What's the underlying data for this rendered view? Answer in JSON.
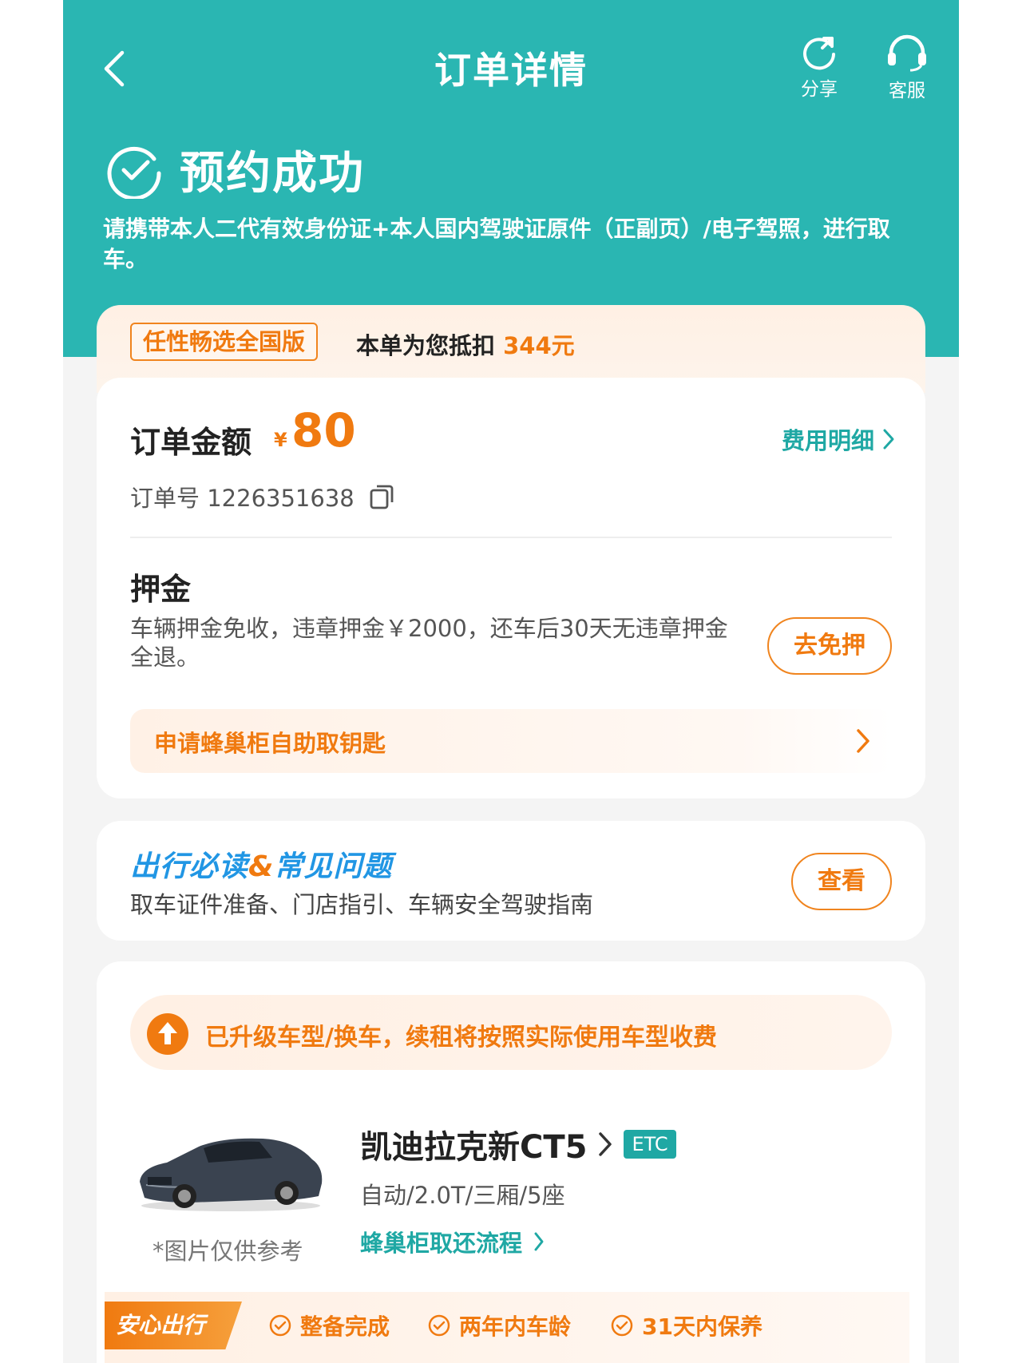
{
  "header": {
    "title": "订单详情",
    "share_label": "分享",
    "service_label": "客服"
  },
  "status": {
    "title": "预约成功",
    "notice": "请携带本人二代有效身份证+本人国内驾驶证原件（正副页）/电子驾照，进行取车。"
  },
  "promo": {
    "tag": "任性畅选全国版",
    "text_prefix": "本单为您抵扣",
    "amount": "344元"
  },
  "order": {
    "label": "订单金额",
    "currency": "¥",
    "amount": "80",
    "fee_link": "费用明细",
    "order_no": "订单号 1226351638"
  },
  "deposit": {
    "title": "押金",
    "desc": "车辆押金免收，违章押金￥2000，还车后30天无违章押金全退。",
    "button": "去免押",
    "locker_link": "申请蜂巢柜自助取钥匙"
  },
  "guide": {
    "title_a": "出行必读",
    "title_amp": "&",
    "title_b": "常见问题",
    "subtitle": "取车证件准备、门店指引、车辆安全驾驶指南",
    "button": "查看"
  },
  "car": {
    "upgrade_notice": "已升级车型/换车，续租将按照实际使用车型收费",
    "name": "凯迪拉克新CT5",
    "badge": "ETC",
    "spec": "自动/2.0T/三厢/5座",
    "flow_link": "蜂巢柜取还流程",
    "image_note": "*图片仅供参考",
    "safe_tag": "安心出行",
    "safe_items": [
      "整备完成",
      "两年内车龄",
      "31天内保养"
    ]
  },
  "colors": {
    "teal": "#2ab6b2",
    "orange": "#f07a10",
    "link_teal": "#1fa8a4",
    "blue": "#2196e4"
  }
}
